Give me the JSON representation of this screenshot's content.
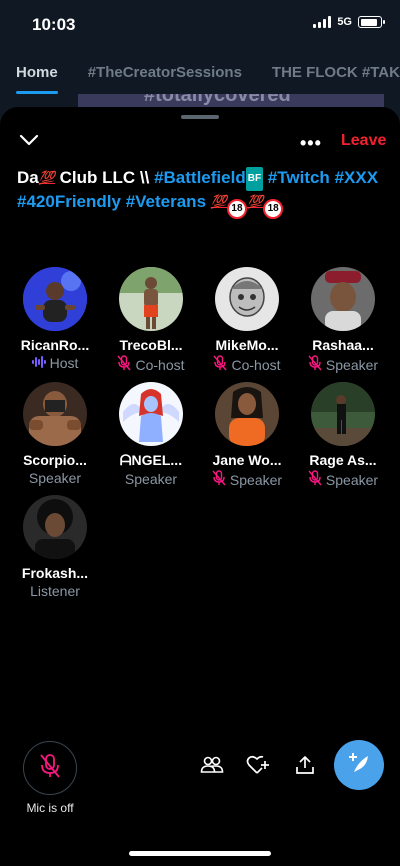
{
  "status_bar": {
    "time": "10:03",
    "network": "5G",
    "battery_level": 0.85
  },
  "background": {
    "tabs": [
      {
        "label": "Home",
        "active": true
      },
      {
        "label": "#TheCreatorSessions",
        "active": false
      },
      {
        "label": "THE FLOCK #TAK",
        "active": false
      }
    ],
    "card_text": "#totallycovered"
  },
  "space": {
    "more_label": "•••",
    "leave_label": "Leave",
    "title_parts": [
      {
        "text": "Da",
        "type": "text"
      },
      {
        "text": "💯",
        "type": "hundred"
      },
      {
        "text": " Club LLC \\\\ ",
        "type": "text"
      },
      {
        "text": "#Battlefield",
        "type": "hash"
      },
      {
        "text": "BF",
        "type": "bf"
      },
      {
        "text": " ",
        "type": "text"
      },
      {
        "text": "#Twitch",
        "type": "hash"
      },
      {
        "text": " ",
        "type": "text"
      },
      {
        "text": "#XXX",
        "type": "hash"
      },
      {
        "text": " ",
        "type": "text"
      },
      {
        "text": "#420Friendly",
        "type": "hash"
      },
      {
        "text": " ",
        "type": "text"
      },
      {
        "text": "#Veterans",
        "type": "hash"
      },
      {
        "text": " ",
        "type": "text"
      },
      {
        "text": "💯",
        "type": "hundred"
      },
      {
        "text": "18",
        "type": "e18"
      },
      {
        "text": "💯",
        "type": "hundred"
      },
      {
        "text": "18",
        "type": "e18"
      }
    ]
  },
  "participants": [
    {
      "name": "RicanRo...",
      "role": "Host",
      "role_icon": "speaking-waveform-icon",
      "muted": false
    },
    {
      "name": "TrecoBl...",
      "role": "Co-host",
      "role_icon": "mic-muted-icon",
      "muted": true
    },
    {
      "name": "MikeMo...",
      "role": "Co-host",
      "role_icon": "mic-muted-icon",
      "muted": true
    },
    {
      "name": "Rashaa...",
      "role": "Speaker",
      "role_icon": "mic-muted-icon",
      "muted": true
    },
    {
      "name": "Scorpio...",
      "role": "Speaker",
      "role_icon": "none",
      "muted": false
    },
    {
      "name": "ᗩNGEL...",
      "role": "Speaker",
      "role_icon": "none",
      "muted": false
    },
    {
      "name": "Jane Wo...",
      "role": "Speaker",
      "role_icon": "mic-muted-icon",
      "muted": true
    },
    {
      "name": "Rage As...",
      "role": "Speaker",
      "role_icon": "mic-muted-icon",
      "muted": true
    },
    {
      "name": "Frokash...",
      "role": "Listener",
      "role_icon": "none",
      "muted": false
    }
  ],
  "bottom_bar": {
    "mic_label": "Mic is off",
    "actions": [
      "people-icon",
      "heart-plus-icon",
      "share-icon"
    ],
    "compose_icon": "compose-plus-icon"
  },
  "colors": {
    "accent": "#1d9bf0",
    "leave": "#f4212e",
    "muted_mic": "#f91880",
    "fab": "#4aa3ea"
  }
}
